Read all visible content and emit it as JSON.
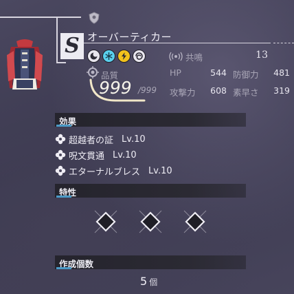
{
  "item": {
    "grade": "S",
    "name": "オーバーティカー",
    "quality_label": "品質",
    "quality_value": "999",
    "quality_max": "/999"
  },
  "elements": [
    {
      "name": "dark-element-icon",
      "color": "#2d2c36"
    },
    {
      "name": "ice-element-icon",
      "color": "#5ad0ee"
    },
    {
      "name": "lightning-element-icon",
      "color": "#f2c21c"
    },
    {
      "name": "wind-element-icon",
      "color": "#2d2c36"
    }
  ],
  "resonance": {
    "label": "共鳴",
    "value": "13"
  },
  "stats": {
    "hp_label": "HP",
    "hp": "544",
    "def_label": "防御力",
    "def": "481",
    "atk_label": "攻撃力",
    "atk": "608",
    "spd_label": "素早さ",
    "spd": "319"
  },
  "sections": {
    "effects": "効果",
    "traits": "特性",
    "count": "作成個数"
  },
  "effects": [
    {
      "name": "超越者の証",
      "level": "Lv.10"
    },
    {
      "name": "呪文貫通",
      "level": "Lv.10"
    },
    {
      "name": "エターナルブレス",
      "level": "Lv.10"
    }
  ],
  "create_count": {
    "value": "5",
    "unit": "個"
  },
  "colors": {
    "accent": "#4b9bc8",
    "quality_arc": "#f1e7c8"
  }
}
